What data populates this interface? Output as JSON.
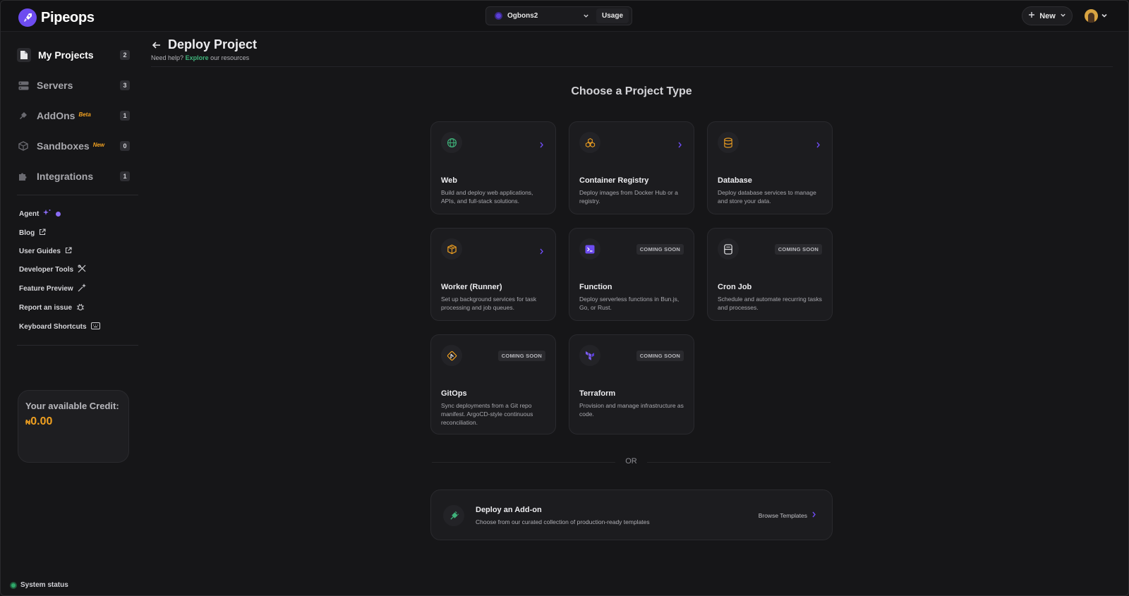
{
  "app": {
    "name": "Pipeops"
  },
  "topbar": {
    "workspace": "Ogbons2",
    "usage_label": "Usage",
    "new_label": "New"
  },
  "sidebar": {
    "nav": [
      {
        "label": "My Projects",
        "count": "2",
        "badge": ""
      },
      {
        "label": "Servers",
        "count": "3",
        "badge": ""
      },
      {
        "label": "AddOns",
        "count": "1",
        "badge": "Beta"
      },
      {
        "label": "Sandboxes",
        "count": "0",
        "badge": "New"
      },
      {
        "label": "Integrations",
        "count": "1",
        "badge": ""
      }
    ],
    "links": [
      {
        "label": "Agent",
        "icon": "sparkle-icon"
      },
      {
        "label": "Blog",
        "icon": "external-link-icon"
      },
      {
        "label": "User Guides",
        "icon": "external-link-icon"
      },
      {
        "label": "Developer Tools",
        "icon": "tools-icon"
      },
      {
        "label": "Feature Preview",
        "icon": "preview-sparkle-icon"
      },
      {
        "label": "Report an issue",
        "icon": "bug-icon"
      },
      {
        "label": "Keyboard Shortcuts",
        "icon": "keyboard-icon"
      }
    ],
    "credit": {
      "label": "Your available Credit:",
      "currency": "₦",
      "amount": "0.00"
    },
    "status_label": "System status"
  },
  "header": {
    "title": "Deploy Project",
    "help_prefix": "Need help?",
    "help_link": "Explore",
    "help_suffix": "our resources"
  },
  "section_title": "Choose a Project Type",
  "cards": [
    {
      "title": "Web",
      "desc": "Build and deploy web applications, APIs, and full-stack solutions.",
      "icon": "globe-icon",
      "status": ""
    },
    {
      "title": "Container Registry",
      "desc": "Deploy images from Docker Hub or a registry.",
      "icon": "containers-icon",
      "status": ""
    },
    {
      "title": "Database",
      "desc": "Deploy database services to manage and store your data.",
      "icon": "database-icon",
      "status": ""
    },
    {
      "title": "Worker (Runner)",
      "desc": "Set up background services for task processing and job queues.",
      "icon": "package-icon",
      "status": ""
    },
    {
      "title": "Function",
      "desc": "Deploy serverless functions in Bun.js, Go, or Rust.",
      "icon": "terminal-icon",
      "status": "COMING SOON"
    },
    {
      "title": "Cron Job",
      "desc": "Schedule and automate recurring tasks and processes.",
      "icon": "hourglass-icon",
      "status": "COMING SOON"
    },
    {
      "title": "GitOps",
      "desc": "Sync deployments from a Git repo manifest. ArgoCD-style continuous reconciliation.",
      "icon": "git-icon",
      "status": "COMING SOON"
    },
    {
      "title": "Terraform",
      "desc": "Provision and manage infrastructure as code.",
      "icon": "terraform-icon",
      "status": "COMING SOON"
    }
  ],
  "or_label": "OR",
  "addon": {
    "title": "Deploy an Add-on",
    "desc": "Choose from our curated collection of production-ready templates",
    "browse_label": "Browse Templates"
  },
  "colors": {
    "accent_purple": "#6d4cf0",
    "accent_green": "#3fb27a",
    "accent_orange": "#f0a020",
    "background": "#161618",
    "card": "#1c1c1f"
  }
}
